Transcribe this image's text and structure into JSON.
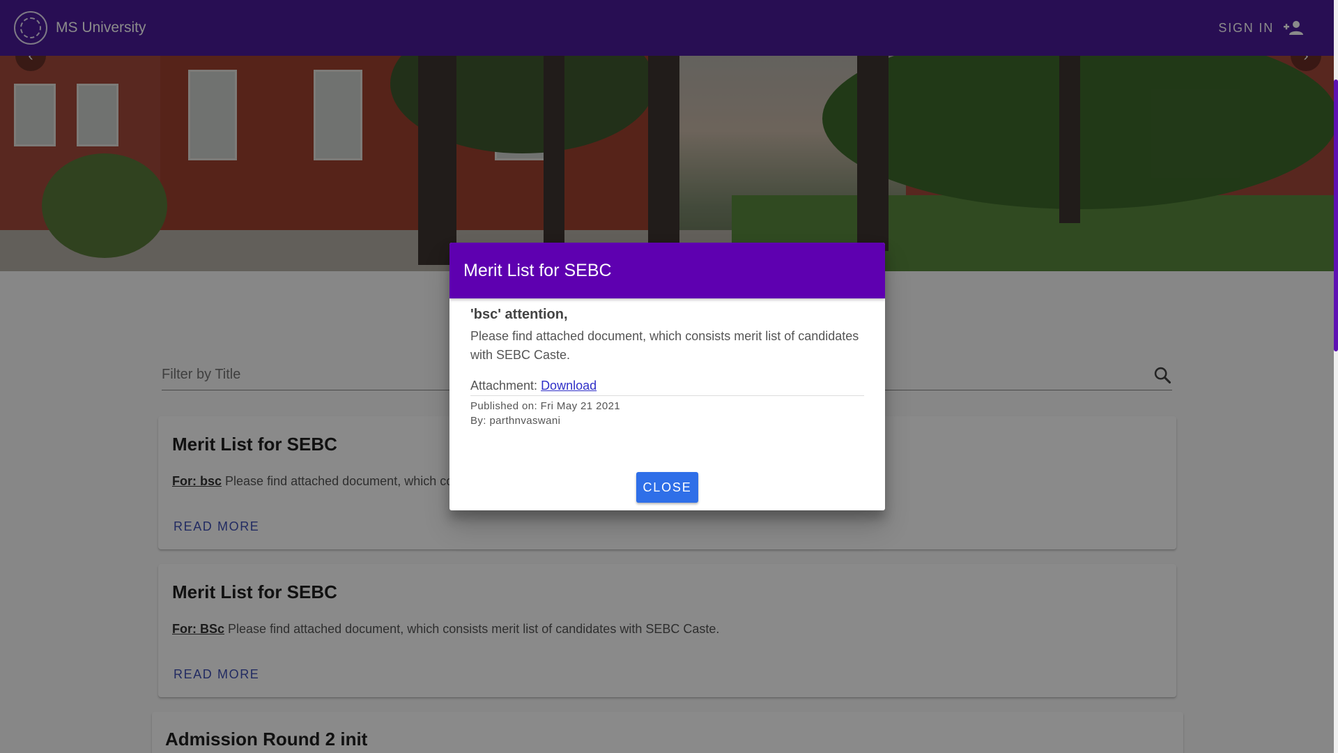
{
  "header": {
    "brand": "MS University",
    "signin_label": "SIGN IN"
  },
  "filter": {
    "placeholder": "Filter by Title"
  },
  "cards": [
    {
      "title": "Merit List for SEBC",
      "for_label": "For: bsc",
      "body": "Please find attached document, which co",
      "read_more": "READ MORE"
    },
    {
      "title": "Merit List for SEBC",
      "for_label": "For: BSc",
      "body": "Please find attached document, which consists merit list of candidates with SEBC Caste.",
      "read_more": "READ MORE"
    },
    {
      "title": "Admission Round 2 init"
    }
  ],
  "dialog": {
    "title": "Merit List for SEBC",
    "attention": "'bsc' attention,",
    "message": "Please find attached document, which consists merit list of candidates with SEBC Caste.",
    "attachment_label": "Attachment:",
    "attachment_link": "Download",
    "published": "Published on: Fri May 21 2021",
    "by": "By: parthnvaswani",
    "close_label": "CLOSE"
  },
  "colors": {
    "appbar": "#4a1a99",
    "dialog_header": "#5e00b0",
    "close_button": "#2f6fe8",
    "link": "#3f51b5"
  },
  "icons": {
    "signin": "person-add-icon",
    "search": "search-icon",
    "logo": "university-seal-logo"
  }
}
